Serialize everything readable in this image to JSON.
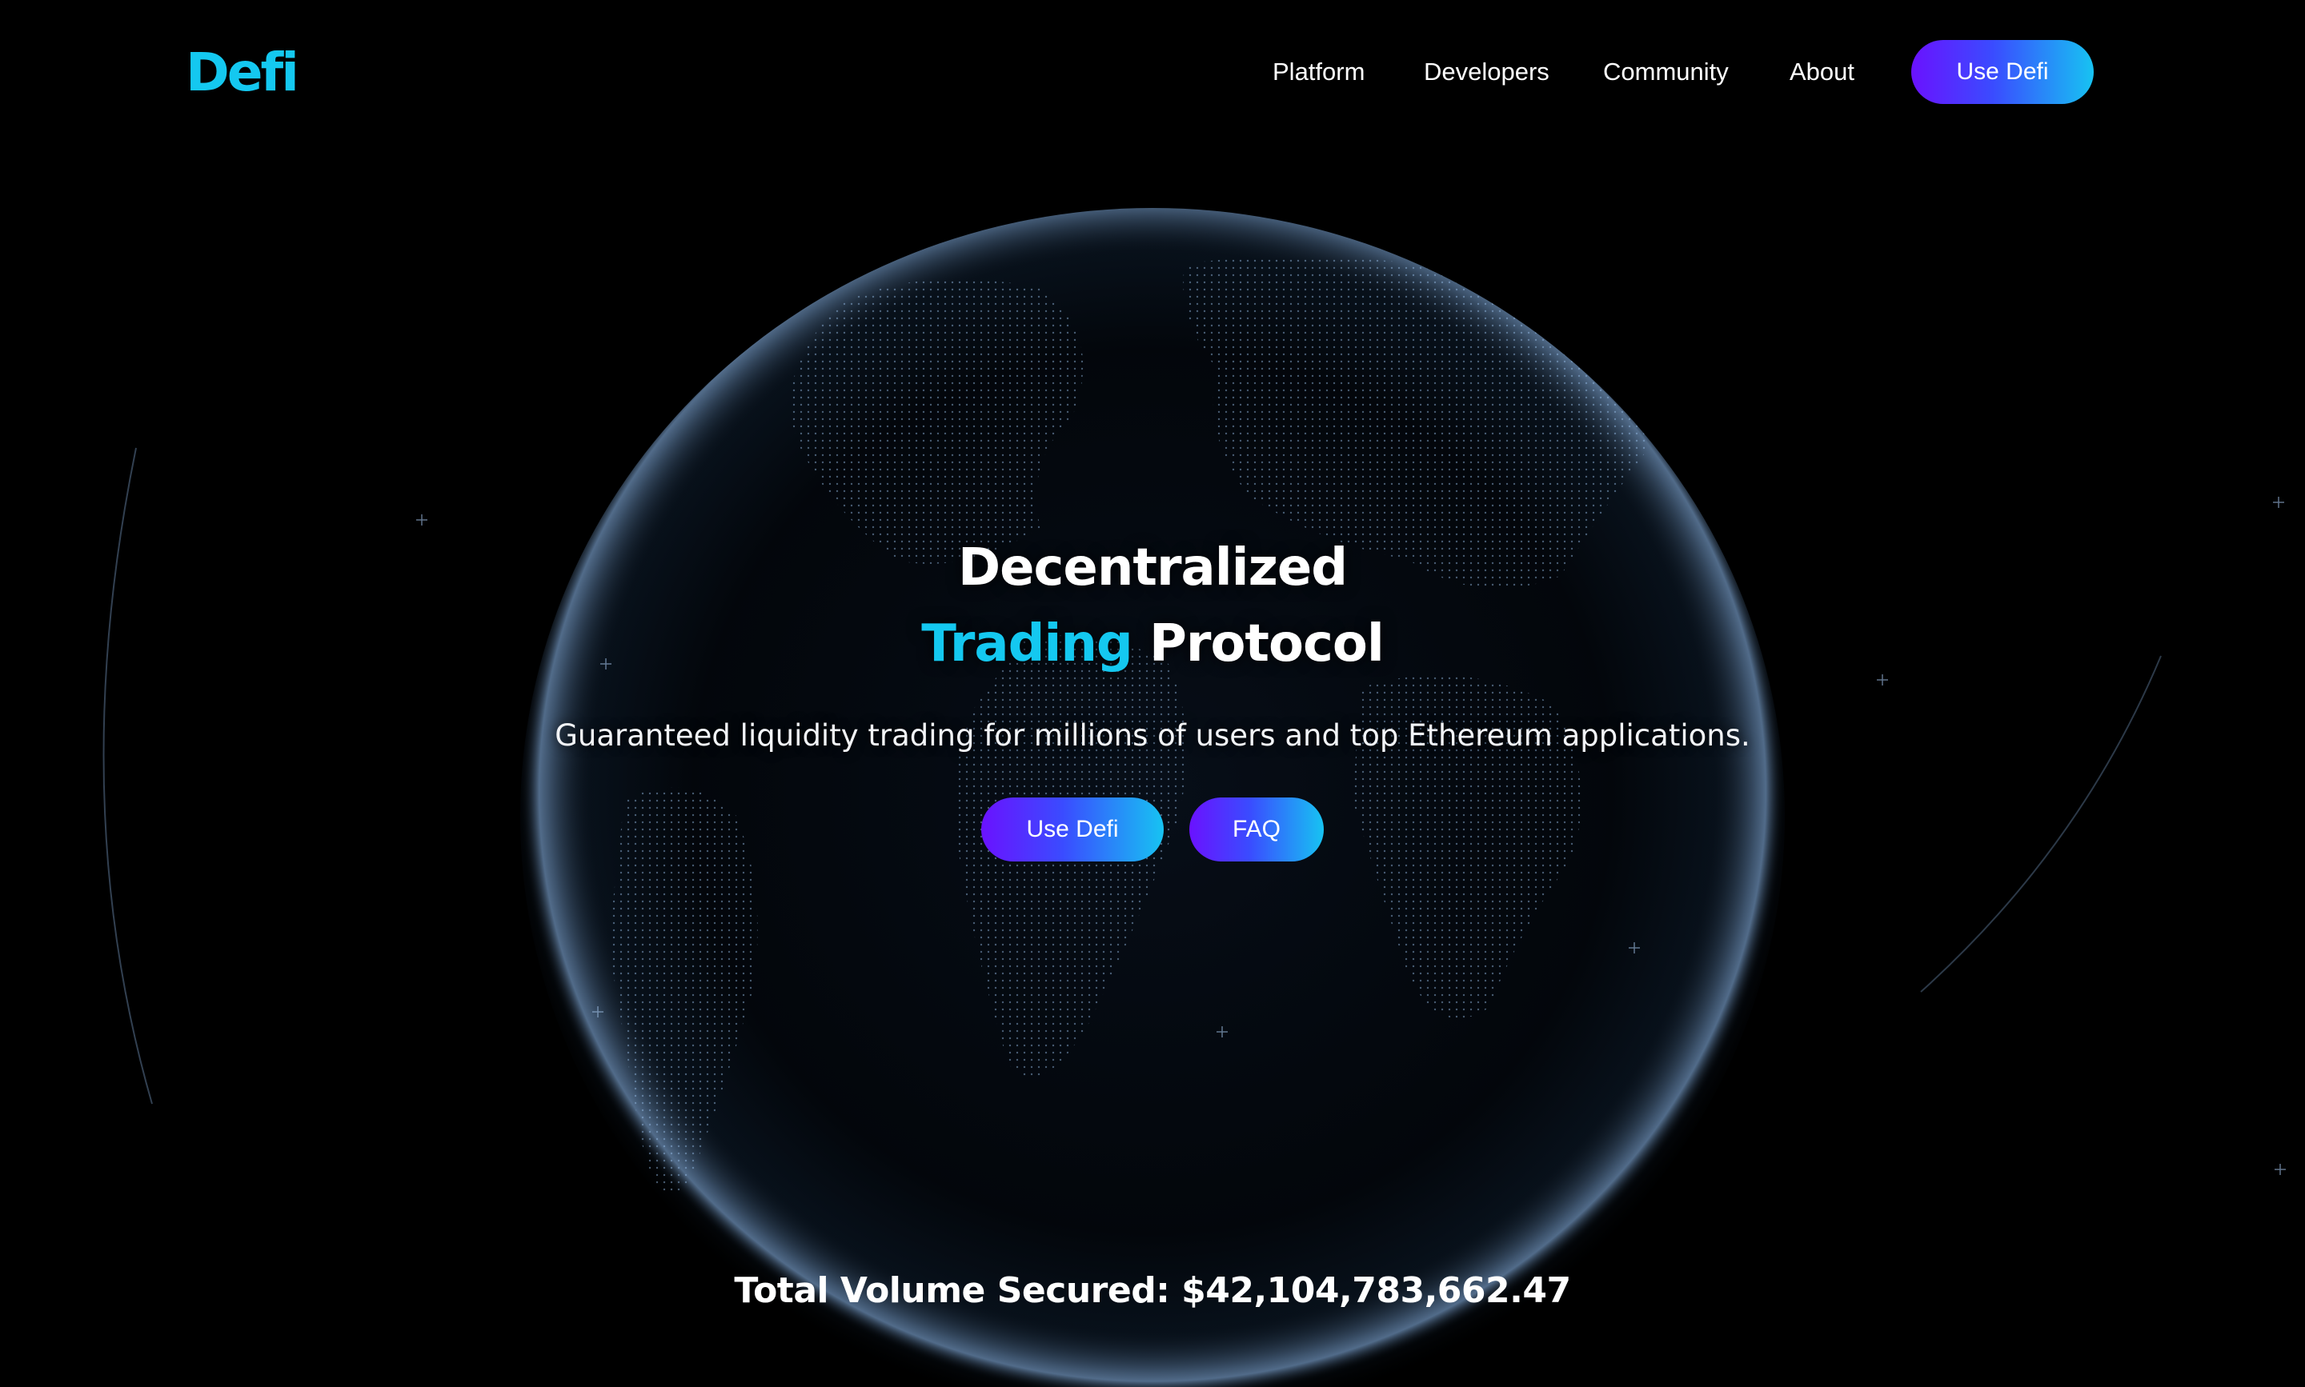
{
  "brand": {
    "logo_text": "Defi",
    "accent_color": "#14c8f0",
    "gradient_start": "#6a12ff",
    "gradient_end": "#17c3f2"
  },
  "nav": {
    "links": [
      "Platform",
      "Developers",
      "Community",
      "About"
    ],
    "cta_label": "Use Defi"
  },
  "hero": {
    "title_line1": "Decentralized",
    "title_accent": "Trading",
    "title_rest": "Protocol",
    "subtitle": "Guaranteed liquidity trading for millions of users and top Ethereum applications.",
    "primary_button": "Use Defi",
    "secondary_button": "FAQ"
  },
  "stats": {
    "volume_label": "Total Volume Secured: $42,104,783,662.47"
  }
}
